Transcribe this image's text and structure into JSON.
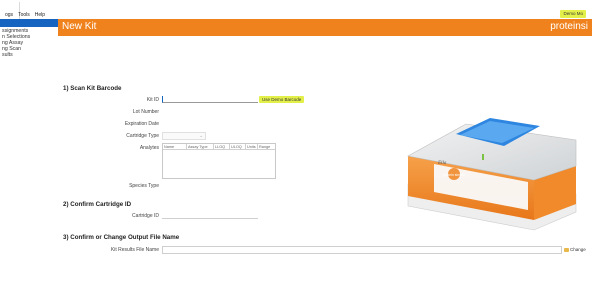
{
  "menu": {
    "items": [
      "ogs",
      "Tools",
      "Help"
    ]
  },
  "demo_badge": "Demo Mo",
  "sidebar": {
    "items": [
      "ssignments",
      "n Selections",
      "ng Assay",
      "ng Scan",
      "sults"
    ]
  },
  "header": {
    "title": "New Kit",
    "brand": "proteinsi"
  },
  "sections": {
    "scan": {
      "title": "1) Scan Kit Barcode",
      "kit_id_label": "Kit ID",
      "use_demo_label": "Use Demo Barcode",
      "lot_number_label": "Lot Number",
      "expiration_label": "Expiration Date",
      "cartridge_type_label": "Cartridge Type",
      "analytes_label": "Analytes",
      "analytes_columns": [
        "Name",
        "Assay Type",
        "LLOQ",
        "ULOQ",
        "Units",
        "Range"
      ],
      "species_type_label": "Species Type"
    },
    "confirm_cartridge": {
      "title": "2) Confirm Cartridge ID",
      "cartridge_id_label": "Cartridge ID"
    },
    "output": {
      "title": "3) Confirm or Change Output File Name",
      "results_label": "Kit Results File Name",
      "change_label": "Change"
    }
  },
  "device": {
    "brand_text": "Ella",
    "panel_logo": "protein simple"
  },
  "colors": {
    "accent": "#f0821e",
    "highlight": "#e3f04a",
    "nav_active": "#1565c0"
  }
}
